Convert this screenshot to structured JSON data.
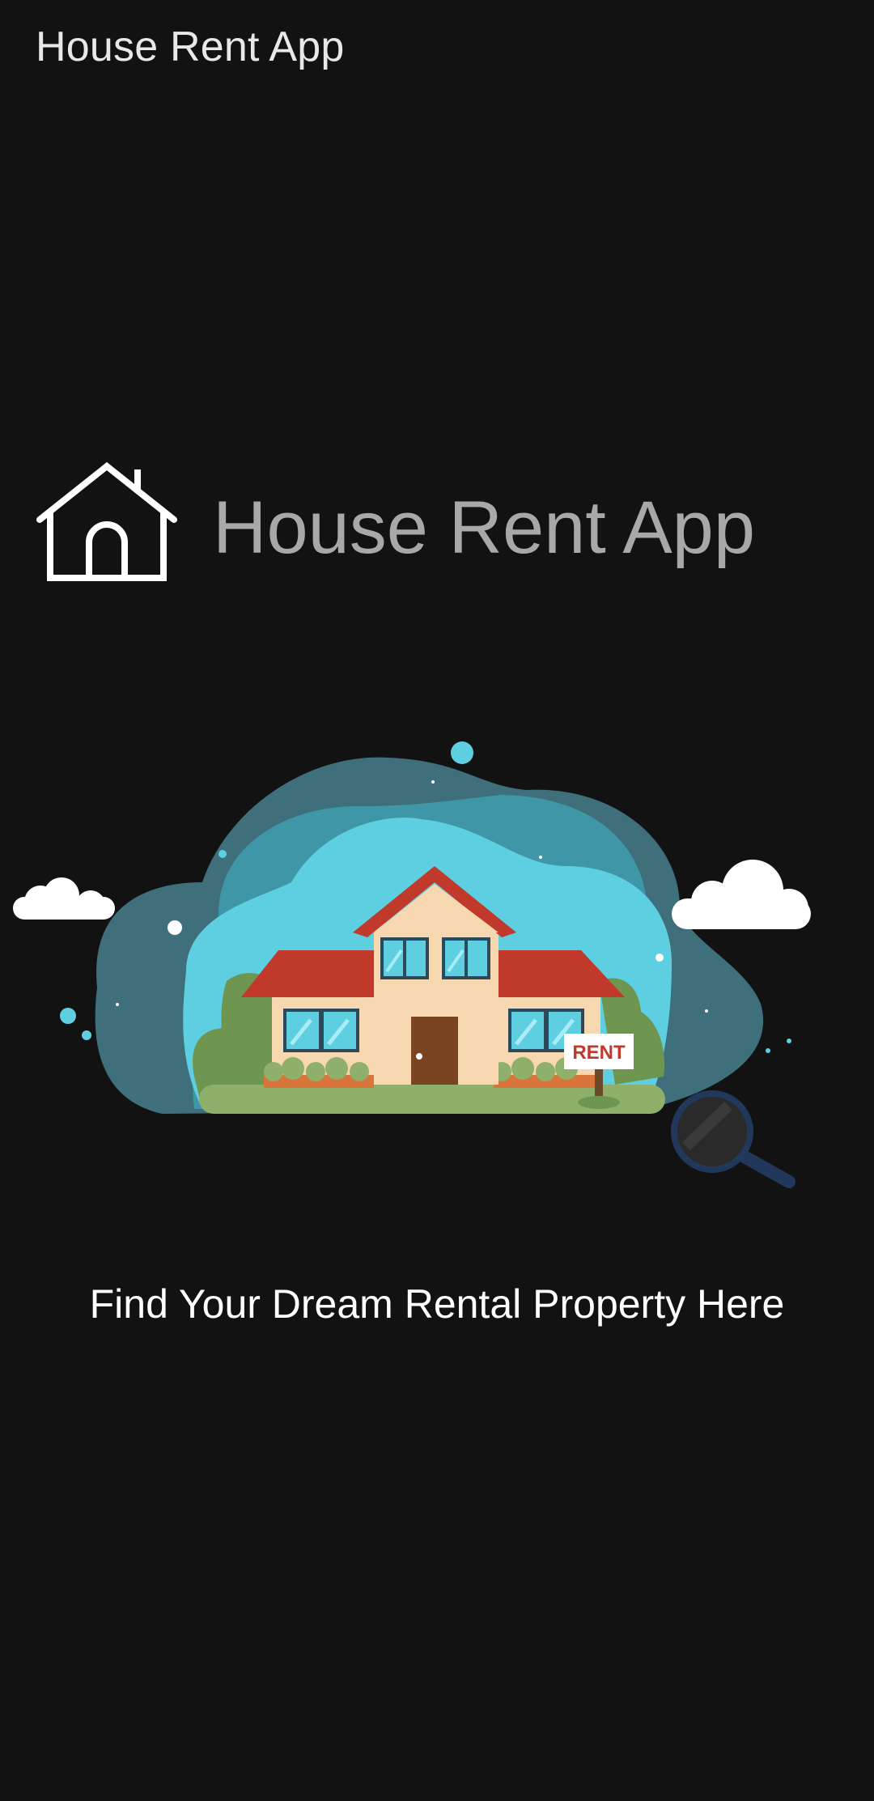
{
  "app_bar": {
    "title": "House Rent App"
  },
  "logo": {
    "icon": "house-outline-icon",
    "title": "House Rent App"
  },
  "hero": {
    "illustration": "house-for-rent-illustration",
    "sign_text": "RENT",
    "magnifier_icon": "magnifier-icon"
  },
  "tagline": "Find Your Dream Rental Property Here",
  "colors": {
    "background": "#121212",
    "title_gray": "#a8a8a8",
    "roof_red": "#c0392b",
    "wall_beige": "#f6d7b0",
    "sky_blue": "#5ecfe0"
  }
}
